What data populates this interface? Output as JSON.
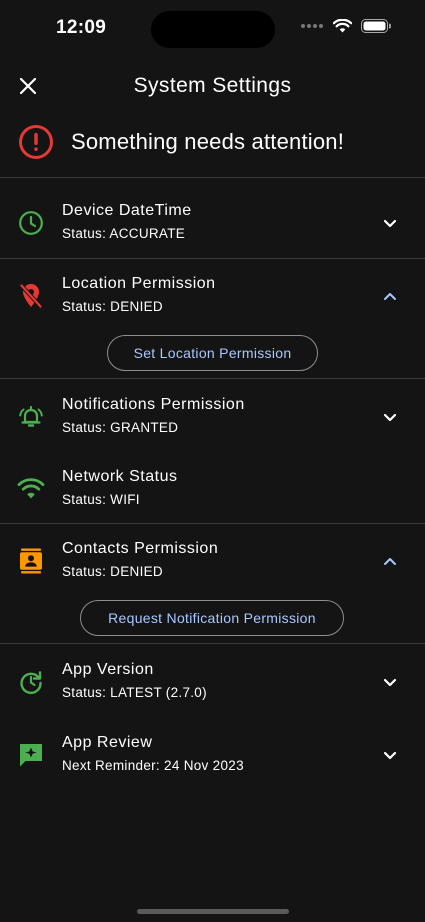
{
  "status_bar": {
    "time": "12:09",
    "icons": [
      "signal-dots-icon",
      "wifi-icon",
      "battery-icon"
    ]
  },
  "header": {
    "title": "System Settings",
    "close_icon": "close-icon"
  },
  "alert": {
    "text": "Something needs attention!",
    "icon": "error-icon",
    "color": "#e53935"
  },
  "rows": [
    {
      "id": "device-datetime",
      "name": "Device DateTime",
      "status": "Status: ACCURATE",
      "icon": "clock-icon",
      "icon_color": "#4caf50",
      "expanded": false
    },
    {
      "id": "location-permission",
      "name": "Location Permission",
      "status": "Status: DENIED",
      "icon": "location-off-icon",
      "icon_color": "#e53935",
      "expanded": true,
      "action": "Set Location Permission"
    },
    {
      "id": "notifications-permission",
      "name": "Notifications Permission",
      "status": "Status: GRANTED",
      "icon": "bell-ringing-icon",
      "icon_color": "#4caf50",
      "expanded": false
    },
    {
      "id": "network-status",
      "name": "Network Status",
      "status": "Status: WIFI",
      "icon": "wifi-icon",
      "icon_color": "#4caf50"
    },
    {
      "id": "contacts-permission",
      "name": "Contacts Permission",
      "status": "Status: DENIED",
      "icon": "contacts-icon",
      "icon_color": "#ff9800",
      "expanded": true,
      "action": "Request Notification Permission"
    },
    {
      "id": "app-version",
      "name": "App Version",
      "status": "Status: LATEST (2.7.0)",
      "icon": "update-icon",
      "icon_color": "#4caf50",
      "expanded": false
    },
    {
      "id": "app-review",
      "name": "App Review",
      "status": "Next Reminder: 24 Nov 2023",
      "icon": "review-icon",
      "icon_color": "#4caf50",
      "expanded": false
    }
  ],
  "colors": {
    "background": "#141414",
    "accent_text": "#a8c8ff",
    "green": "#4caf50",
    "red": "#e53935",
    "orange": "#ff9800"
  }
}
